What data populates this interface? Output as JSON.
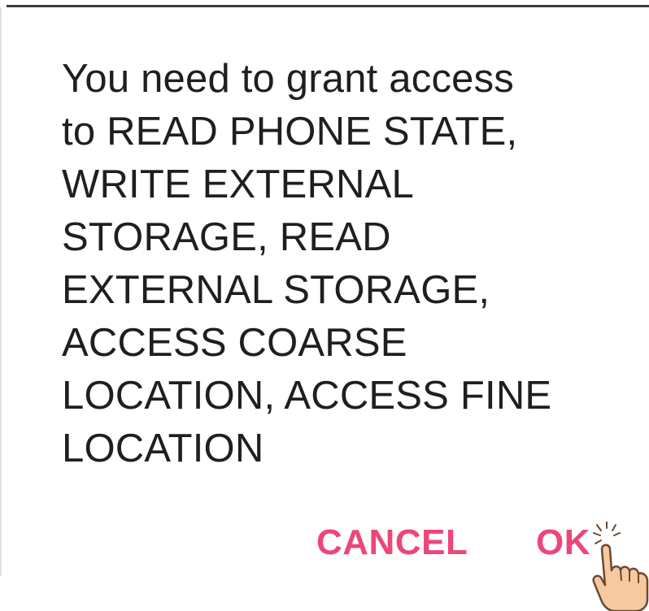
{
  "dialog": {
    "message": "You need to grant access\nto READ PHONE STATE,\nWRITE EXTERNAL\nSTORAGE, READ\nEXTERNAL STORAGE,\nACCESS COARSE\nLOCATION, ACCESS FINE\nLOCATION",
    "cancel_label": "CANCEL",
    "ok_label": "OK"
  },
  "colors": {
    "accent": "#ed4679",
    "text": "#1f1f1f",
    "hand_fill": "#f6c9a0",
    "hand_outline": "#6b4a33"
  },
  "icons": {
    "tap_hint": "pointing-hand-icon"
  }
}
